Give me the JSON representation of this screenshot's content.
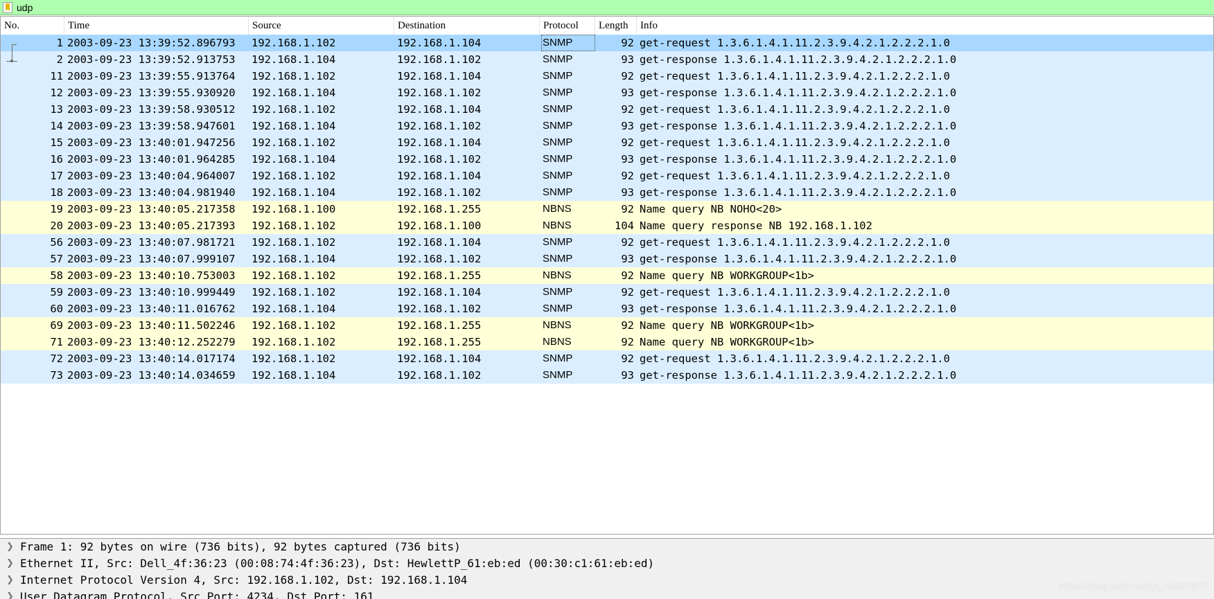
{
  "filter": {
    "value": "udp",
    "bookmark_icon": "bookmark-icon"
  },
  "columns": {
    "no": "No.",
    "time": "Time",
    "source": "Source",
    "destination": "Destination",
    "protocol": "Protocol",
    "length": "Length",
    "info": "Info"
  },
  "colors": {
    "snmp_row": "#daeeff",
    "nbns_row": "#ffffd8",
    "selected_row": "#a8d8ff",
    "filter_bg": "#afffaf"
  },
  "packets": [
    {
      "no": "1",
      "time": "2003-09-23 13:39:52.896793",
      "src": "192.168.1.102",
      "dst": "192.168.1.104",
      "proto": "SNMP",
      "len": "92",
      "info": "get-request 1.3.6.1.4.1.11.2.3.9.4.2.1.2.2.2.1.0"
    },
    {
      "no": "2",
      "time": "2003-09-23 13:39:52.913753",
      "src": "192.168.1.104",
      "dst": "192.168.1.102",
      "proto": "SNMP",
      "len": "93",
      "info": "get-response 1.3.6.1.4.1.11.2.3.9.4.2.1.2.2.2.1.0"
    },
    {
      "no": "11",
      "time": "2003-09-23 13:39:55.913764",
      "src": "192.168.1.102",
      "dst": "192.168.1.104",
      "proto": "SNMP",
      "len": "92",
      "info": "get-request 1.3.6.1.4.1.11.2.3.9.4.2.1.2.2.2.1.0"
    },
    {
      "no": "12",
      "time": "2003-09-23 13:39:55.930920",
      "src": "192.168.1.104",
      "dst": "192.168.1.102",
      "proto": "SNMP",
      "len": "93",
      "info": "get-response 1.3.6.1.4.1.11.2.3.9.4.2.1.2.2.2.1.0"
    },
    {
      "no": "13",
      "time": "2003-09-23 13:39:58.930512",
      "src": "192.168.1.102",
      "dst": "192.168.1.104",
      "proto": "SNMP",
      "len": "92",
      "info": "get-request 1.3.6.1.4.1.11.2.3.9.4.2.1.2.2.2.1.0"
    },
    {
      "no": "14",
      "time": "2003-09-23 13:39:58.947601",
      "src": "192.168.1.104",
      "dst": "192.168.1.102",
      "proto": "SNMP",
      "len": "93",
      "info": "get-response 1.3.6.1.4.1.11.2.3.9.4.2.1.2.2.2.1.0"
    },
    {
      "no": "15",
      "time": "2003-09-23 13:40:01.947256",
      "src": "192.168.1.102",
      "dst": "192.168.1.104",
      "proto": "SNMP",
      "len": "92",
      "info": "get-request 1.3.6.1.4.1.11.2.3.9.4.2.1.2.2.2.1.0"
    },
    {
      "no": "16",
      "time": "2003-09-23 13:40:01.964285",
      "src": "192.168.1.104",
      "dst": "192.168.1.102",
      "proto": "SNMP",
      "len": "93",
      "info": "get-response 1.3.6.1.4.1.11.2.3.9.4.2.1.2.2.2.1.0"
    },
    {
      "no": "17",
      "time": "2003-09-23 13:40:04.964007",
      "src": "192.168.1.102",
      "dst": "192.168.1.104",
      "proto": "SNMP",
      "len": "92",
      "info": "get-request 1.3.6.1.4.1.11.2.3.9.4.2.1.2.2.2.1.0"
    },
    {
      "no": "18",
      "time": "2003-09-23 13:40:04.981940",
      "src": "192.168.1.104",
      "dst": "192.168.1.102",
      "proto": "SNMP",
      "len": "93",
      "info": "get-response 1.3.6.1.4.1.11.2.3.9.4.2.1.2.2.2.1.0"
    },
    {
      "no": "19",
      "time": "2003-09-23 13:40:05.217358",
      "src": "192.168.1.100",
      "dst": "192.168.1.255",
      "proto": "NBNS",
      "len": "92",
      "info": "Name query NB NOHO<20>"
    },
    {
      "no": "20",
      "time": "2003-09-23 13:40:05.217393",
      "src": "192.168.1.102",
      "dst": "192.168.1.100",
      "proto": "NBNS",
      "len": "104",
      "info": "Name query response NB 192.168.1.102"
    },
    {
      "no": "56",
      "time": "2003-09-23 13:40:07.981721",
      "src": "192.168.1.102",
      "dst": "192.168.1.104",
      "proto": "SNMP",
      "len": "92",
      "info": "get-request 1.3.6.1.4.1.11.2.3.9.4.2.1.2.2.2.1.0"
    },
    {
      "no": "57",
      "time": "2003-09-23 13:40:07.999107",
      "src": "192.168.1.104",
      "dst": "192.168.1.102",
      "proto": "SNMP",
      "len": "93",
      "info": "get-response 1.3.6.1.4.1.11.2.3.9.4.2.1.2.2.2.1.0"
    },
    {
      "no": "58",
      "time": "2003-09-23 13:40:10.753003",
      "src": "192.168.1.102",
      "dst": "192.168.1.255",
      "proto": "NBNS",
      "len": "92",
      "info": "Name query NB WORKGROUP<1b>"
    },
    {
      "no": "59",
      "time": "2003-09-23 13:40:10.999449",
      "src": "192.168.1.102",
      "dst": "192.168.1.104",
      "proto": "SNMP",
      "len": "92",
      "info": "get-request 1.3.6.1.4.1.11.2.3.9.4.2.1.2.2.2.1.0"
    },
    {
      "no": "60",
      "time": "2003-09-23 13:40:11.016762",
      "src": "192.168.1.104",
      "dst": "192.168.1.102",
      "proto": "SNMP",
      "len": "93",
      "info": "get-response 1.3.6.1.4.1.11.2.3.9.4.2.1.2.2.2.1.0"
    },
    {
      "no": "69",
      "time": "2003-09-23 13:40:11.502246",
      "src": "192.168.1.102",
      "dst": "192.168.1.255",
      "proto": "NBNS",
      "len": "92",
      "info": "Name query NB WORKGROUP<1b>"
    },
    {
      "no": "71",
      "time": "2003-09-23 13:40:12.252279",
      "src": "192.168.1.102",
      "dst": "192.168.1.255",
      "proto": "NBNS",
      "len": "92",
      "info": "Name query NB WORKGROUP<1b>"
    },
    {
      "no": "72",
      "time": "2003-09-23 13:40:14.017174",
      "src": "192.168.1.102",
      "dst": "192.168.1.104",
      "proto": "SNMP",
      "len": "92",
      "info": "get-request 1.3.6.1.4.1.11.2.3.9.4.2.1.2.2.2.1.0"
    },
    {
      "no": "73",
      "time": "2003-09-23 13:40:14.034659",
      "src": "192.168.1.104",
      "dst": "192.168.1.102",
      "proto": "SNMP",
      "len": "93",
      "info": "get-response 1.3.6.1.4.1.11.2.3.9.4.2.1.2.2.2.1.0"
    }
  ],
  "selected_index": 0,
  "details": [
    "Frame 1: 92 bytes on wire (736 bits), 92 bytes captured (736 bits)",
    "Ethernet II, Src: Dell_4f:36:23 (00:08:74:4f:36:23), Dst: HewlettP_61:eb:ed (00:30:c1:61:eb:ed)",
    "Internet Protocol Version 4, Src: 192.168.1.102, Dst: 192.168.1.104",
    "User Datagram Protocol, Src Port: 4234, Dst Port: 161"
  ],
  "details_expand_icon": "chevron-right-icon",
  "watermark": "https://blog.csdn.net/qq_44851675"
}
